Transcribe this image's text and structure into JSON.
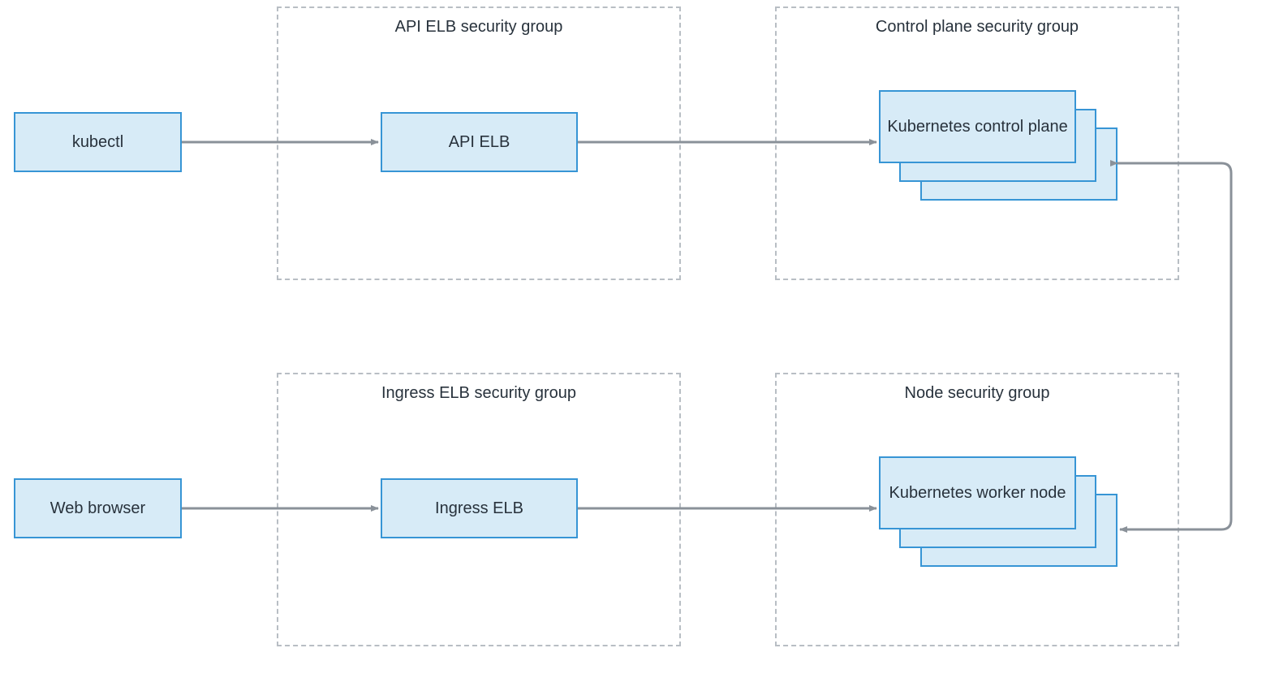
{
  "colors": {
    "node_fill": "#d7ebf7",
    "node_border": "#3795d5",
    "group_border": "#b8bec4",
    "arrow": "#8a9199",
    "text": "#28323c"
  },
  "clients": {
    "kubectl": "kubectl",
    "web_browser": "Web browser"
  },
  "groups": {
    "api_elb_sg": "API ELB security group",
    "control_plane_sg": "Control plane security group",
    "ingress_elb_sg": "Ingress ELB security group",
    "node_sg": "Node security group"
  },
  "nodes": {
    "api_elb": "API ELB",
    "control_plane": "Kubernetes control plane",
    "ingress_elb": "Ingress ELB",
    "worker_node": "Kubernetes worker node"
  },
  "edges": [
    {
      "from": "kubectl",
      "to": "api_elb"
    },
    {
      "from": "api_elb",
      "to": "control_plane"
    },
    {
      "from": "web_browser",
      "to": "ingress_elb"
    },
    {
      "from": "ingress_elb",
      "to": "worker_node"
    },
    {
      "from": "control_plane",
      "to": "worker_node",
      "bidirectional_loop": true
    }
  ]
}
